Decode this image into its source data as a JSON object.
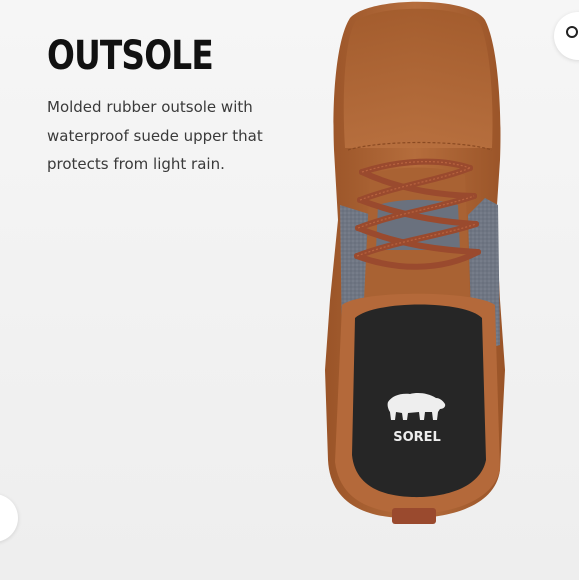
{
  "feature": {
    "title": "OUTSOLE",
    "description": "Molded rubber outsole with waterproof suede upper that protects from light rain."
  },
  "product_image": {
    "brand_logo_text": "SOREL",
    "colors": {
      "suede": "#b06838",
      "felt": "#6f7683",
      "laces": "#9a4a2e",
      "insole": "#262626"
    }
  },
  "controls": {
    "next_icon": "circle-icon",
    "prev_icon": "circle-icon"
  }
}
